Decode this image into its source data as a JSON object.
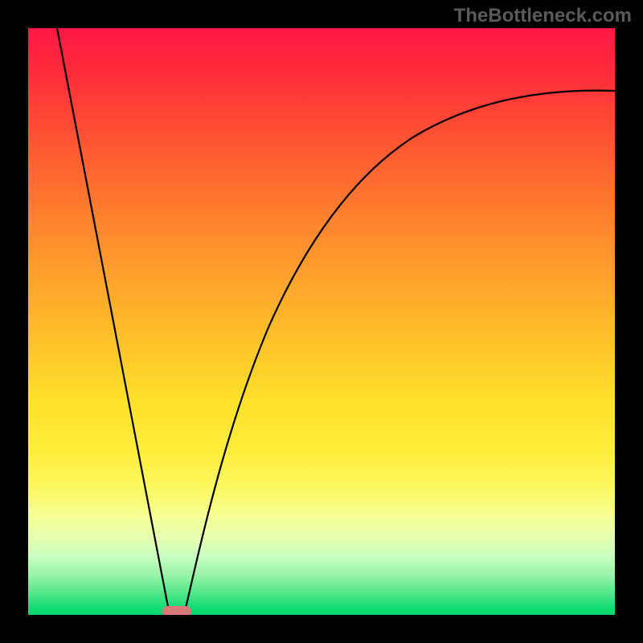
{
  "watermark": "TheBottleneck.com",
  "chart_data": {
    "type": "line",
    "title": "",
    "xlabel": "",
    "ylabel": "",
    "xlim": [
      0,
      100
    ],
    "ylim": [
      0,
      100
    ],
    "grid": false,
    "legend": false,
    "series": [
      {
        "name": "left-branch",
        "x": [
          5,
          10,
          14,
          18,
          22,
          24
        ],
        "y": [
          100,
          78,
          57,
          37,
          16,
          0
        ]
      },
      {
        "name": "right-branch",
        "x": [
          27,
          29,
          32,
          36,
          40,
          45,
          50,
          56,
          63,
          71,
          80,
          90,
          100
        ],
        "y": [
          0,
          12,
          26,
          40,
          51,
          60,
          67,
          73,
          78,
          82,
          85,
          87.5,
          89
        ]
      }
    ],
    "marker": {
      "x": 25,
      "y": 0
    }
  },
  "colors": {
    "background": "#000000",
    "curve": "#000000",
    "marker": "#d87a78",
    "gradient_top": "#ff1744",
    "gradient_bottom": "#00d76b"
  }
}
